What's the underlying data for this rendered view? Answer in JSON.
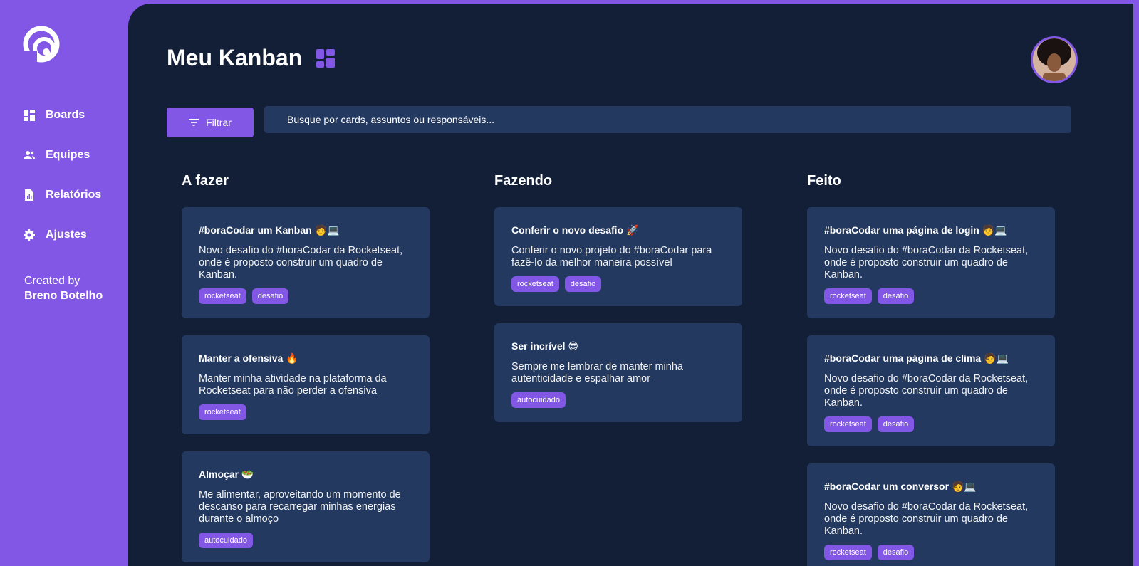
{
  "sidebar": {
    "items": [
      {
        "label": "Boards",
        "icon": "grid-icon"
      },
      {
        "label": "Equipes",
        "icon": "users-icon"
      },
      {
        "label": "Relatórios",
        "icon": "report-icon"
      },
      {
        "label": "Ajustes",
        "icon": "gear-icon"
      }
    ],
    "credit_prefix": "Created by",
    "credit_author": "Breno Botelho"
  },
  "header": {
    "title": "Meu Kanban",
    "filter_label": "Filtrar",
    "search_placeholder": "Busque por cards, assuntos ou responsáveis..."
  },
  "colors": {
    "accent": "#8257e5",
    "background": "#131f36",
    "card": "#233960"
  },
  "columns": [
    {
      "title": "A fazer",
      "cards": [
        {
          "title": "#boraCodar um Kanban 🧑💻",
          "desc": "Novo desafio do #boraCodar da Rocketseat, onde é proposto construir um quadro de Kanban.",
          "tags": [
            "rocketseat",
            "desafio"
          ]
        },
        {
          "title": "Manter a ofensiva 🔥",
          "desc": "Manter minha atividade na plataforma da Rocketseat para não perder a ofensiva",
          "tags": [
            "rocketseat"
          ]
        },
        {
          "title": "Almoçar 🥗",
          "desc": "Me alimentar, aproveitando um momento de descanso para recarregar minhas energias durante o almoço",
          "tags": [
            "autocuidado"
          ]
        }
      ]
    },
    {
      "title": "Fazendo",
      "cards": [
        {
          "title": "Conferir o novo desafio 🚀",
          "desc": "Conferir o novo projeto do #boraCodar para fazê-lo da melhor maneira possível",
          "tags": [
            "rocketseat",
            "desafio"
          ]
        },
        {
          "title": "Ser incrível 😎",
          "desc": "Sempre me lembrar de manter minha autenticidade e espalhar amor",
          "tags": [
            "autocuidado"
          ]
        }
      ]
    },
    {
      "title": "Feito",
      "cards": [
        {
          "title": "#boraCodar uma página de login 🧑💻",
          "desc": "Novo desafio do #boraCodar da Rocketseat, onde é proposto construir um quadro de Kanban.",
          "tags": [
            "rocketseat",
            "desafio"
          ]
        },
        {
          "title": "#boraCodar uma página de clima 🧑💻",
          "desc": "Novo desafio do #boraCodar da Rocketseat, onde é proposto construir um quadro de Kanban.",
          "tags": [
            "rocketseat",
            "desafio"
          ]
        },
        {
          "title": "#boraCodar um conversor 🧑💻",
          "desc": "Novo desafio do #boraCodar da Rocketseat, onde é proposto construir um quadro de Kanban.",
          "tags": [
            "rocketseat",
            "desafio"
          ]
        }
      ]
    }
  ]
}
